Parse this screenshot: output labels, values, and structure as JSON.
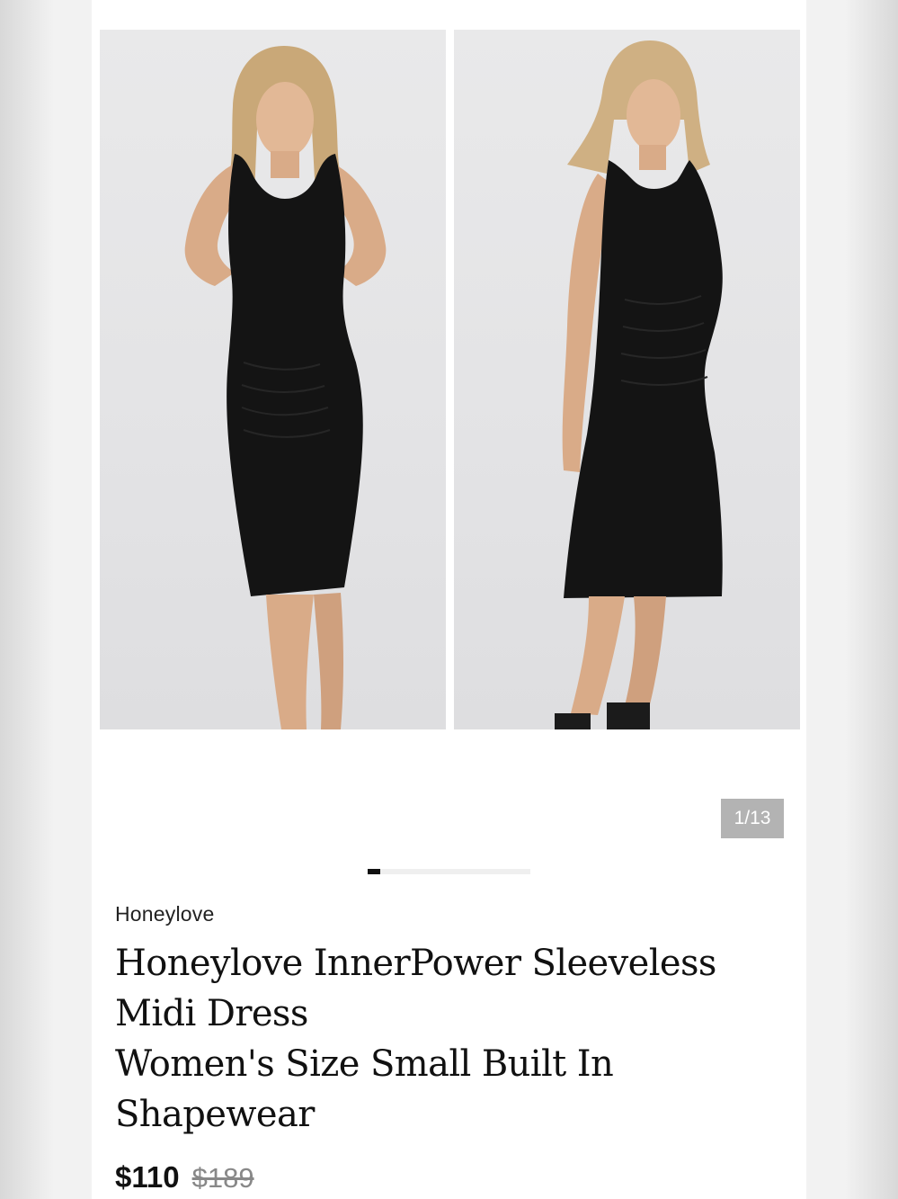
{
  "gallery": {
    "images": [
      {
        "alt": "front-view",
        "dress_color": "#141414",
        "background": "#e6e6e8"
      },
      {
        "alt": "side-view",
        "dress_color": "#141414",
        "background": "#e6e6e8"
      }
    ],
    "counter": "1/13",
    "progress_fraction": 0.077
  },
  "product": {
    "brand": "Honeylove",
    "title_lines": [
      "Honeylove InnerPower Sleeveless",
      "Midi Dress",
      "Women's Size Small Built In",
      "Shapewear"
    ],
    "price": "$110",
    "original_price": "$189"
  },
  "colors": {
    "accent": "#111111",
    "badge": "#b3b3b3"
  }
}
